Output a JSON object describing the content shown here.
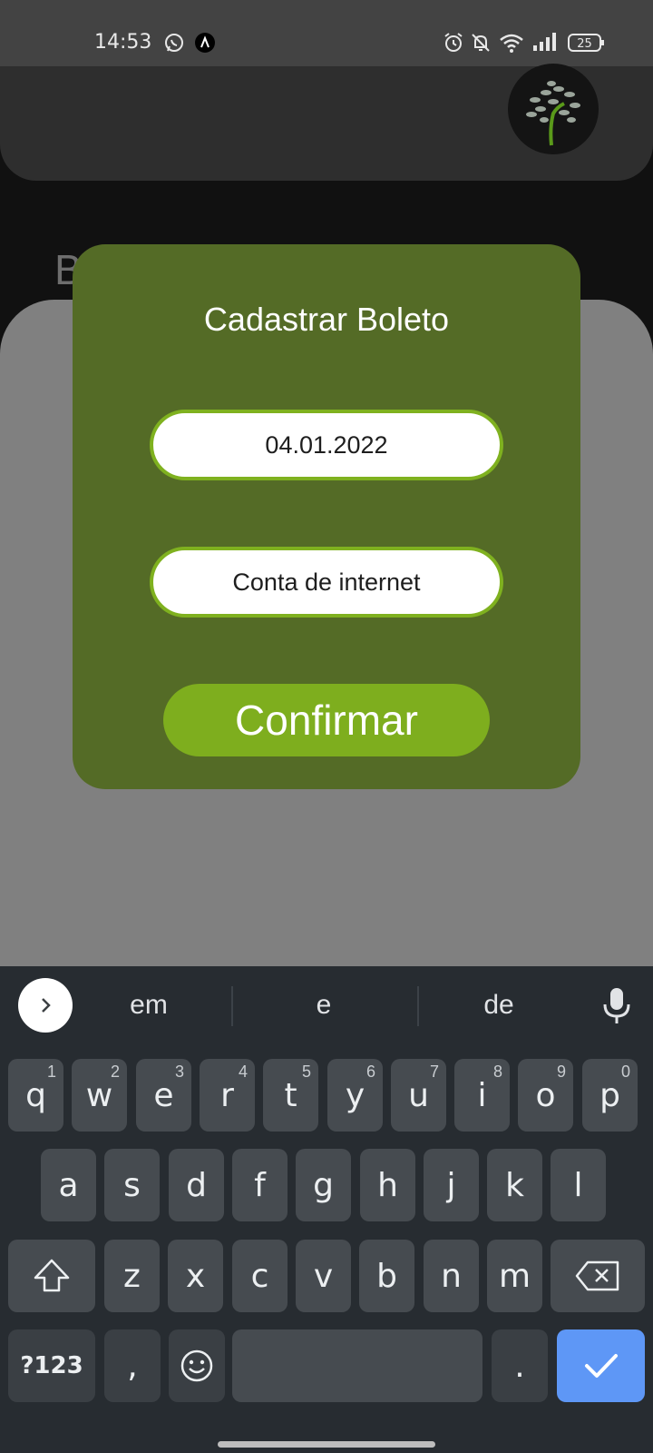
{
  "status_bar": {
    "time": "14:53",
    "battery": "25",
    "left_icons": [
      "whatsapp-icon",
      "app-notification-icon"
    ],
    "right_icons": [
      "alarm-icon",
      "notifications-muted-icon",
      "wifi-icon",
      "signal-icon",
      "battery-icon"
    ]
  },
  "background": {
    "title_fragment": "B"
  },
  "modal": {
    "title": "Cadastrar Boleto",
    "date_value": "04.01.2022",
    "description_value": "Conta de internet",
    "confirm_label": "Confirmar"
  },
  "keyboard": {
    "suggestions": [
      "em",
      "e",
      "de"
    ],
    "row1": [
      {
        "label": "q",
        "hint": "1"
      },
      {
        "label": "w",
        "hint": "2"
      },
      {
        "label": "e",
        "hint": "3"
      },
      {
        "label": "r",
        "hint": "4"
      },
      {
        "label": "t",
        "hint": "5"
      },
      {
        "label": "y",
        "hint": "6"
      },
      {
        "label": "u",
        "hint": "7"
      },
      {
        "label": "i",
        "hint": "8"
      },
      {
        "label": "o",
        "hint": "9"
      },
      {
        "label": "p",
        "hint": "0"
      }
    ],
    "row2": [
      "a",
      "s",
      "d",
      "f",
      "g",
      "h",
      "j",
      "k",
      "l"
    ],
    "row3": [
      "z",
      "x",
      "c",
      "v",
      "b",
      "n",
      "m"
    ],
    "symbols_label": "?123",
    "comma_label": ",",
    "period_label": "."
  },
  "colors": {
    "modal_bg": "#546b26",
    "accent_green": "#7eae1e",
    "keyboard_bg": "#272c31",
    "enter_key": "#5e97f6"
  }
}
